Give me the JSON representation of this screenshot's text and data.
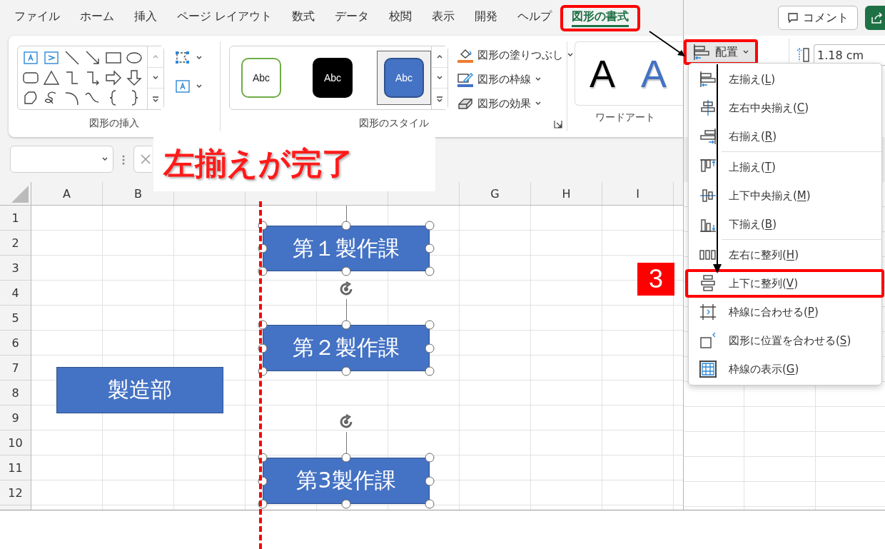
{
  "tabs": [
    {
      "label": "ファイル",
      "selected": false,
      "highlighted": false
    },
    {
      "label": "ホーム",
      "selected": false,
      "highlighted": false
    },
    {
      "label": "挿入",
      "selected": false,
      "highlighted": false
    },
    {
      "label": "ページ レイアウト",
      "selected": false,
      "highlighted": false
    },
    {
      "label": "数式",
      "selected": false,
      "highlighted": false
    },
    {
      "label": "データ",
      "selected": false,
      "highlighted": false
    },
    {
      "label": "校閲",
      "selected": false,
      "highlighted": false
    },
    {
      "label": "表示",
      "selected": false,
      "highlighted": false
    },
    {
      "label": "開発",
      "selected": false,
      "highlighted": false
    },
    {
      "label": "ヘルプ",
      "selected": false,
      "highlighted": false
    },
    {
      "label": "図形の書式",
      "selected": true,
      "highlighted": true
    }
  ],
  "comment_button": {
    "label": "コメント"
  },
  "insert_shapes_group": {
    "label": "図形の挿入"
  },
  "shape_styles_group": {
    "label": "図形のスタイル",
    "styles": [
      {
        "label": "Abc",
        "kind": "outline",
        "selected": false
      },
      {
        "label": "Abc",
        "kind": "dark",
        "selected": false
      },
      {
        "label": "Abc",
        "kind": "accent",
        "selected": true
      }
    ],
    "commands": [
      {
        "label": "図形の塗りつぶし",
        "kind": "fill"
      },
      {
        "label": "図形の枠線",
        "kind": "outline"
      },
      {
        "label": "図形の効果",
        "kind": "effects"
      }
    ]
  },
  "wordart_group": {
    "label": "ワードアート",
    "samples": [
      {
        "label": "A",
        "kind": "plain"
      },
      {
        "label": "A",
        "kind": "accent"
      }
    ]
  },
  "arrange_button": {
    "label": "配置",
    "highlighted": true
  },
  "size_field": {
    "value": "1.18 cm"
  },
  "sheet": {
    "columns": [
      "A",
      "B",
      null,
      null,
      null,
      null,
      "G",
      "H",
      "I"
    ],
    "rows": [
      "1",
      "2",
      "3",
      "4",
      "5",
      "6",
      "7",
      "8",
      "9",
      "10",
      "11",
      "12"
    ],
    "shapes": [
      {
        "label": "第１製作課",
        "selected": true,
        "rotate_handle": false
      },
      {
        "label": "第２製作課",
        "selected": true,
        "rotate_handle": true
      },
      {
        "label": "第3製作課",
        "selected": true,
        "rotate_handle": true
      },
      {
        "label": "製造部",
        "selected": false,
        "rotate_handle": false
      }
    ]
  },
  "menu": {
    "groups": [
      [
        {
          "before": "左揃え(",
          "key": "L",
          "after": ")",
          "kind": "align-left",
          "highlighted": false
        },
        {
          "before": "左右中央揃え(",
          "key": "C",
          "after": ")",
          "kind": "align-center",
          "highlighted": false
        },
        {
          "before": "右揃え(",
          "key": "R",
          "after": ")",
          "kind": "align-right",
          "highlighted": false
        }
      ],
      [
        {
          "before": "上揃え(",
          "key": "T",
          "after": ")",
          "kind": "align-top",
          "highlighted": false
        },
        {
          "before": "上下中央揃え(",
          "key": "M",
          "after": ")",
          "kind": "align-middle",
          "highlighted": false
        },
        {
          "before": "下揃え(",
          "key": "B",
          "after": ")",
          "kind": "align-bottom",
          "highlighted": false
        }
      ],
      [
        {
          "before": "左右に整列(",
          "key": "H",
          "after": ")",
          "kind": "distribute-horizontal",
          "highlighted": false
        },
        {
          "before": "上下に整列(",
          "key": "V",
          "after": ")",
          "kind": "distribute-vertical",
          "highlighted": true
        },
        {
          "before": "枠線に合わせる(",
          "key": "P",
          "after": ")",
          "kind": "snap-grid",
          "highlighted": false
        },
        {
          "before": "図形に位置を合わせる(",
          "key": "S",
          "after": ")",
          "kind": "snap-shape",
          "highlighted": false
        },
        {
          "before": "枠線の表示(",
          "key": "G",
          "after": ")",
          "kind": "view-grid",
          "highlighted": false
        }
      ]
    ]
  },
  "callout": {
    "text": "左揃えが完了"
  },
  "step_badge": {
    "text": "3"
  }
}
